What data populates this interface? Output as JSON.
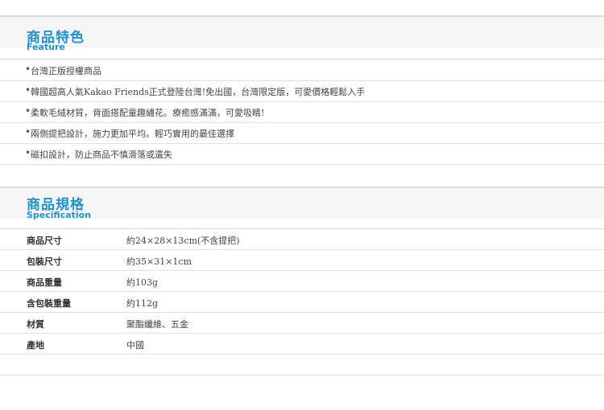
{
  "feature": {
    "title_zh": "商品特色",
    "title_en": "Feature",
    "bullet": "•",
    "items": [
      "台灣正版授權商品",
      "韓國超高人氣Kakao Friends正式登陸台灣!免出國，台灣限定版，可愛價格輕鬆入手",
      "柔軟毛絨材質，背面搭配童趣繡花。療癒感滿滿，可愛吸睛!",
      "兩側提把設計，施力更加平均。輕巧實用的最佳選擇",
      "磁扣設計，防止商品不慎滑落或遺失"
    ]
  },
  "specification": {
    "title_zh": "商品規格",
    "title_en": "Specification",
    "rows": [
      {
        "label": "商品尺寸",
        "value": "約24×28×13cm(不含提把)"
      },
      {
        "label": "包裝尺寸",
        "value": "約35×31×1cm"
      },
      {
        "label": "商品重量",
        "value": "約103g"
      },
      {
        "label": "含包裝重量",
        "value": "約112g"
      },
      {
        "label": "材質",
        "value": "聚酯纖維、五金"
      },
      {
        "label": "產地",
        "value": "中國"
      }
    ]
  },
  "colors": {
    "accent": "#1e93d3",
    "header_bg": "#f6f6f6",
    "divider": "#e1e1e1"
  }
}
